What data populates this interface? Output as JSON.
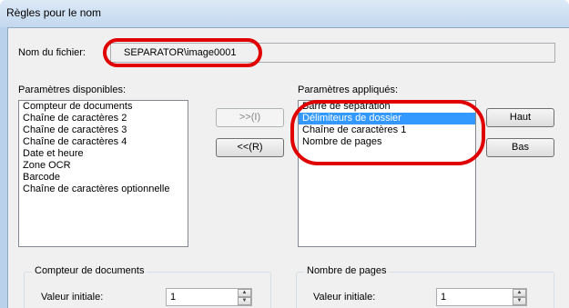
{
  "window": {
    "title": "Règles pour le nom"
  },
  "filename": {
    "label": "Nom du fichier:",
    "value": "SEPARATOR\\image0001"
  },
  "available": {
    "label": "Paramètres disponibles:",
    "items": [
      "Compteur de documents",
      "Chaîne de caractères 2",
      "Chaîne de caractères 3",
      "Chaîne de caractères 4",
      "Date et heure",
      "Zone OCR",
      "Barcode",
      "Chaîne de caractères optionnelle"
    ]
  },
  "applied": {
    "label": "Paramètres appliqués:",
    "items": [
      "Barre de séparation",
      "Délimiteurs de dossier",
      "Chaîne de caractères 1",
      "Nombre de pages"
    ],
    "selected_index": 1
  },
  "buttons": {
    "add": ">>(I)",
    "remove": "<<(R)",
    "up": "Haut",
    "down": "Bas"
  },
  "doc_counter": {
    "group_title": "Compteur de documents",
    "initial_label": "Valeur initiale:",
    "initial_value": "1"
  },
  "page_count": {
    "group_title": "Nombre de pages",
    "initial_label": "Valeur initiale:",
    "initial_value": "1"
  },
  "colors": {
    "highlight_ring": "#e00000",
    "selection": "#3399ff"
  }
}
